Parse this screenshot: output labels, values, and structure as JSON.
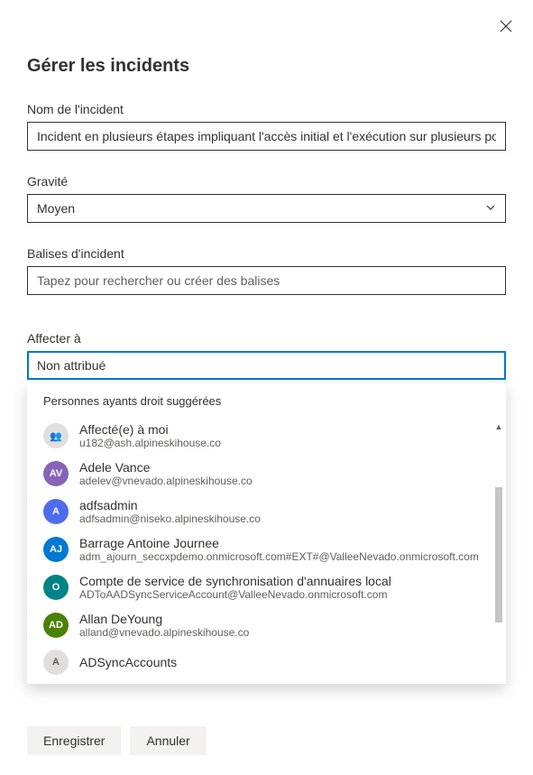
{
  "dialog": {
    "title": "Gérer les incidents"
  },
  "fields": {
    "incidentName": {
      "label": "Nom de l'incident",
      "value": "Incident en plusieurs étapes impliquant l'accès initial et l'exécution sur plusieurs points de terminaison"
    },
    "severity": {
      "label": "Gravité",
      "value": "Moyen"
    },
    "tags": {
      "label": "Balises d'incident",
      "placeholder": "Tapez pour rechercher ou créer des balises"
    },
    "assignTo": {
      "label": "Affecter à",
      "value": "Non attribué"
    }
  },
  "suggestions": {
    "header": "Personnes ayants droit suggérées",
    "items": [
      {
        "initials": "👥",
        "name": "Affecté(e) à moi",
        "email": "u182@ash.alpineskihouse.co",
        "bg": "#e1dfdd",
        "me": true
      },
      {
        "initials": "AV",
        "name": "Adele Vance",
        "email": "adelev@vnevado.alpineskihouse.co",
        "bg": "#8764b8"
      },
      {
        "initials": "A",
        "name": "adfsadmin",
        "email": "adfsadmin@niseko.alpineskihouse.co",
        "bg": "#4f6bed"
      },
      {
        "initials": "AJ",
        "name": "Barrage Antoine Journee",
        "email": "adm_ajourn_seccxpdemo.onmicrosoft.com#EXT#@ValleeNevado.onmicrosoft.com",
        "bg": "#0078d4"
      },
      {
        "initials": "O",
        "name": "Compte de service de synchronisation d'annuaires local",
        "email": "ADToAADSyncServiceAccount@ValleeNevado.onmicrosoft.com",
        "bg": "#038387"
      },
      {
        "initials": "AD",
        "name": "Allan DeYoung",
        "email": "alland@vnevado.alpineskihouse.co",
        "bg": "#498205"
      },
      {
        "initials": "A",
        "name": "ADSyncAccounts",
        "email": "",
        "bg": "#e1dfdd",
        "me": true
      }
    ]
  },
  "buttons": {
    "save": "Enregistrer",
    "cancel": "Annuler"
  }
}
